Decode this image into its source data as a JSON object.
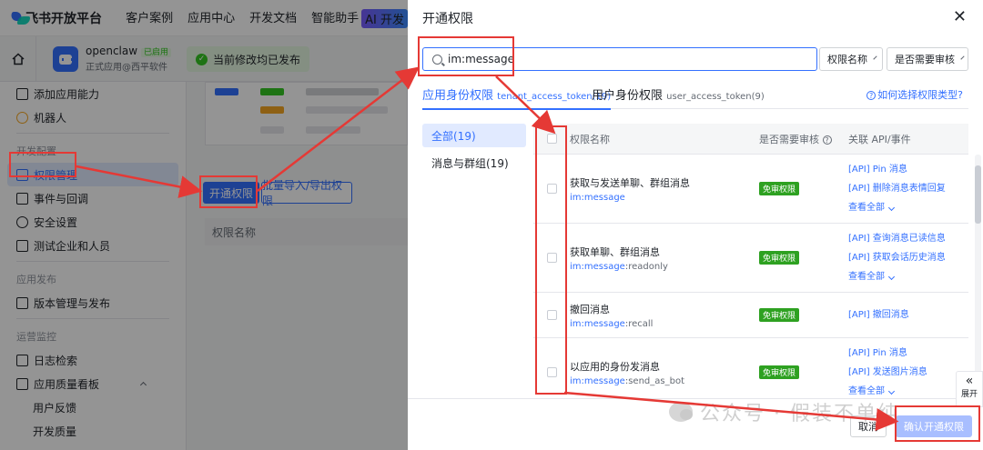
{
  "topbar": {
    "brand": "飞书开放平台",
    "nav": [
      "客户案例",
      "应用中心",
      "开发文档",
      "智能助手"
    ],
    "ai_badge": "AI 开发"
  },
  "app": {
    "name": "openclaw",
    "status": "已启用",
    "subtitle": "正式应用@西平软件",
    "publish_notice": "当前修改均已发布"
  },
  "sidebar": {
    "top_items": [
      "添加应用能力",
      "机器人"
    ],
    "section_dev": "开发配置",
    "dev_items": [
      "权限管理",
      "事件与回调",
      "安全设置",
      "测试企业和人员"
    ],
    "section_publish": "应用发布",
    "publish_items": [
      "版本管理与发布"
    ],
    "section_ops": "运营监控",
    "ops_items": [
      "日志检索",
      "应用质量看板"
    ],
    "ops_sub_items": [
      "用户反馈",
      "开发质量"
    ]
  },
  "main": {
    "open_perm_button": "开通权限",
    "batch_button": "批量导入/导出权限",
    "table_header": "权限名称"
  },
  "modal": {
    "title": "开通权限",
    "search_value": "im:message",
    "filter_perm_name": "权限名称",
    "filter_audit": "是否需要审核",
    "tab_tenant": "应用身份权限",
    "tab_tenant_code": "tenant_access_token(19)",
    "tab_user": "用户身份权限",
    "tab_user_code": "user_access_token(9)",
    "help_link": "如何选择权限类型?",
    "categories": [
      "全部(19)",
      "消息与群组(19)"
    ],
    "columns": {
      "name": "权限名称",
      "audit": "是否需要审核",
      "api": "关联 API/事件"
    },
    "rows": [
      {
        "name": "获取与发送单聊、群组消息",
        "code_prefix": "im:message",
        "code_suffix": "",
        "audit": "免审权限",
        "apis": [
          "[API] Pin 消息",
          "[API] 删除消息表情回复"
        ],
        "more": "查看全部"
      },
      {
        "name": "获取单聊、群组消息",
        "code_prefix": "im:message",
        "code_suffix": ":readonly",
        "audit": "免审权限",
        "apis": [
          "[API] 查询消息已读信息",
          "[API] 获取会话历史消息"
        ],
        "more": "查看全部"
      },
      {
        "name": "撤回消息",
        "code_prefix": "im:message",
        "code_suffix": ":recall",
        "audit": "免审权限",
        "apis": [
          "[API] 撤回消息"
        ],
        "more": ""
      },
      {
        "name": "以应用的身份发消息",
        "code_prefix": "im:message",
        "code_suffix": ":send_as_bot",
        "audit": "免审权限",
        "apis": [
          "[API] Pin 消息",
          "[API] 发送图片消息"
        ],
        "more": "查看全部"
      }
    ],
    "cancel": "取消",
    "confirm": "确认开通权限",
    "expand": "展开"
  },
  "watermark": "公众号 · 假装不单纯",
  "colors": {
    "accent": "#3370ff",
    "annotation": "#e53935",
    "success": "#34c724"
  }
}
